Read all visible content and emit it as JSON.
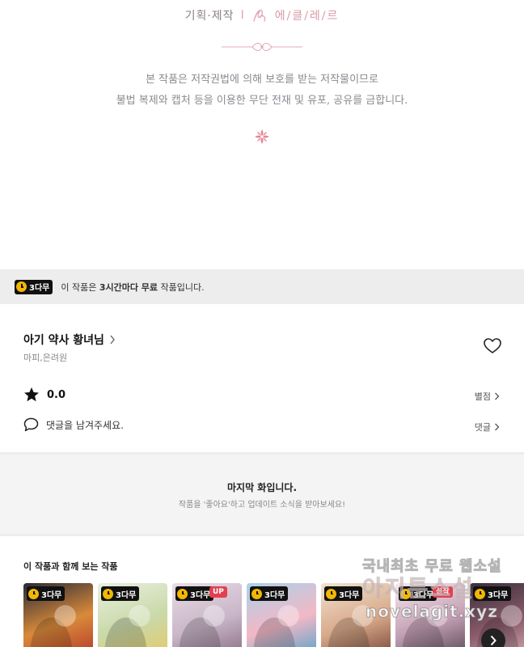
{
  "credits": {
    "label": "기획·제작",
    "separator": "I",
    "studio_name": "에/클/레/르",
    "copyright_line1": "본 작품은 저작권법에 의해 보호를 받는 저작물이므로",
    "copyright_line2": "불법 복제와 캡처 등을 이용한 무단 전재 및 유포, 공유를 금합니다."
  },
  "free_banner": {
    "badge": "3다무",
    "text_prefix": "이 작품은 ",
    "text_bold": "3시간마다 무료",
    "text_suffix": " 작품입니다."
  },
  "work": {
    "title": "아기 약사 황녀님",
    "authors": "마피,은려원",
    "rating": "0.0",
    "rate_label": "별점",
    "comment_placeholder": "댓글을 남겨주세요.",
    "comment_label": "댓글"
  },
  "last_episode": {
    "title": "마지막 화입니다.",
    "subtitle": "작품을 '좋아요'하고 업데이트 소식을 받아보세요!"
  },
  "recommendations": {
    "title": "이 작품과 함께 보는 작품",
    "items": [
      {
        "badge": "3다무",
        "tag": "",
        "colors": [
          "#2a2a35",
          "#d98a3a",
          "#b53a2a"
        ]
      },
      {
        "badge": "3다무",
        "tag": "",
        "colors": [
          "#e9efe0",
          "#c9d9a8",
          "#e6c96a"
        ]
      },
      {
        "badge": "3다무",
        "tag": "UP",
        "tag_color": "#e2404f",
        "colors": [
          "#e8dce6",
          "#c9b6c8",
          "#8a6f86"
        ]
      },
      {
        "badge": "3다무",
        "tag": "",
        "colors": [
          "#a9d2ea",
          "#f2b8c6",
          "#5aa3c9"
        ]
      },
      {
        "badge": "3다무",
        "tag": "",
        "colors": [
          "#f1e2cf",
          "#d8a98a",
          "#7a4a3a"
        ]
      },
      {
        "badge": "3다무",
        "tag": "신작",
        "tag_color": "#e2404f",
        "colors": [
          "#f5e9ef",
          "#c4a0b4",
          "#5a4a5a"
        ]
      },
      {
        "badge": "3다무",
        "tag": "",
        "colors": [
          "#3a2f3a",
          "#8a5a6a",
          "#d9b2b8"
        ]
      }
    ]
  },
  "watermark": {
    "line1": "국내최초 무료 웹소설",
    "line2": "아지툰소설",
    "line3": "novelagit.xyz"
  },
  "icons": {
    "heart": "heart-icon",
    "star": "star-icon",
    "comment": "comment-icon",
    "next": "chevron-right-icon",
    "clock": "clock-icon"
  },
  "colors": {
    "badge_bg": "#111111",
    "clock_yellow": "#f2b705",
    "accent_pink": "#d79aa6",
    "banner_bg": "#ededed"
  }
}
